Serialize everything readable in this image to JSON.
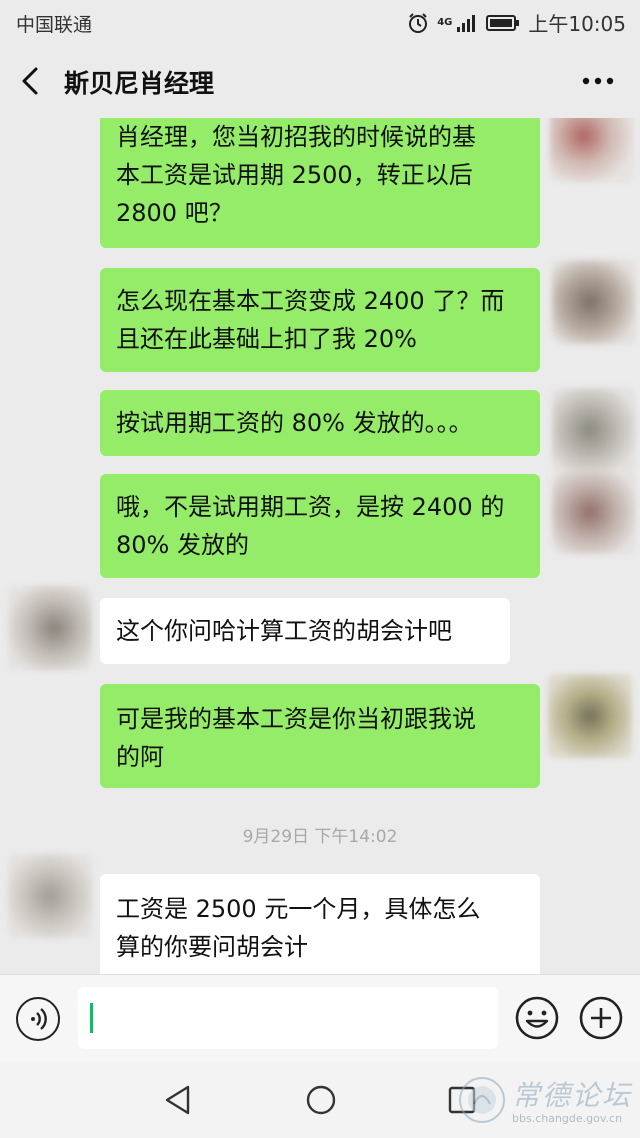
{
  "status_bar": {
    "carrier": "中国联通",
    "network": "4G",
    "time": "上午10:05"
  },
  "header": {
    "title": "斯贝尼肖经理"
  },
  "messages": [
    {
      "direction": "out",
      "text": "肖经理，您当初招我的时候说的基\n本工资是试用期 2500，转正以后\n2800 吧？"
    },
    {
      "direction": "out",
      "text": "怎么现在基本工资变成 2400 了？而\n且还在此基础上扣了我 20%"
    },
    {
      "direction": "out",
      "text": "按试用期工资的 80% 发放的。。。"
    },
    {
      "direction": "out",
      "text": "哦，不是试用期工资，是按 2400 的\n80% 发放的"
    },
    {
      "direction": "in",
      "text": "这个你问哈计算工资的胡会计吧"
    },
    {
      "direction": "out",
      "text": "可是我的基本工资是你当初跟我说\n的阿"
    },
    {
      "direction": "in",
      "text": "工资是 2500 元一个月，具体怎么\n算的你要问胡会计"
    }
  ],
  "timestamp": "9月29日 下午14:02",
  "input": {
    "value": "",
    "placeholder": ""
  },
  "watermark": {
    "title": "常德论坛",
    "url": "bbs.changde.gov.cn"
  },
  "colors": {
    "outgoing_bubble": "#95ec69",
    "incoming_bubble": "#ffffff",
    "background": "#ebebeb",
    "caret": "#07c160"
  },
  "icons": {
    "back": "chevron-left-icon",
    "more": "more-dots-icon",
    "voice": "voice-icon",
    "emoji": "emoji-icon",
    "plus": "plus-icon",
    "nav_back": "triangle-back-icon",
    "nav_home": "circle-home-icon",
    "nav_recent": "square-recent-icon"
  }
}
